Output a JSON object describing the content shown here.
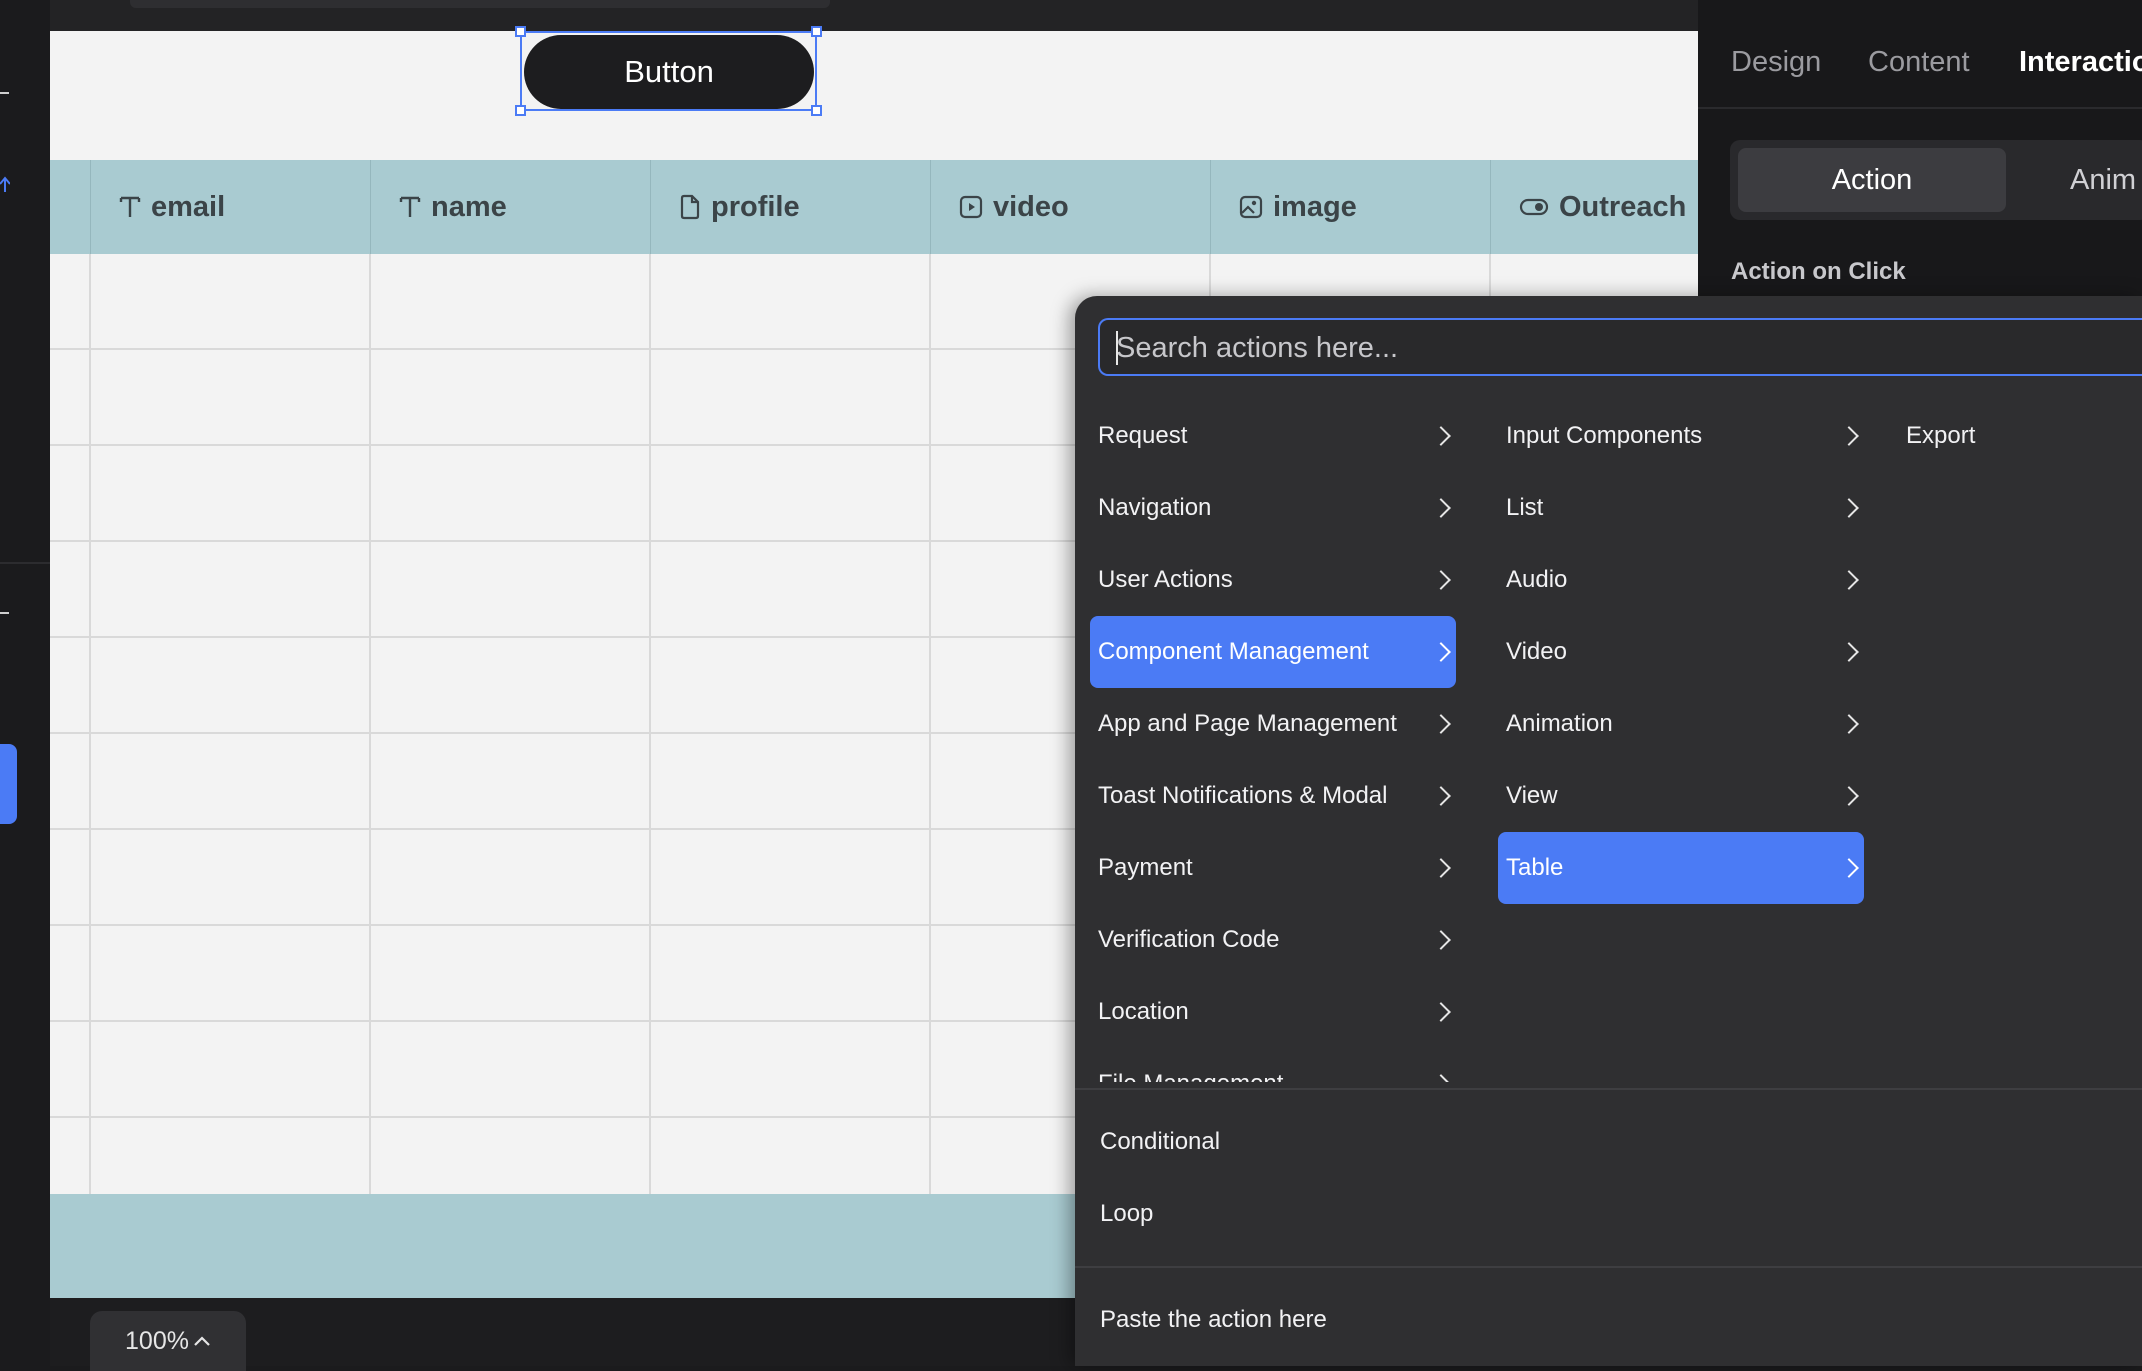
{
  "canvas": {
    "button_label": "Button",
    "zoom_label": "100%"
  },
  "table": {
    "columns": [
      {
        "label": "email",
        "icon": "text-type-icon"
      },
      {
        "label": "name",
        "icon": "text-type-icon"
      },
      {
        "label": "profile",
        "icon": "file-icon"
      },
      {
        "label": "video",
        "icon": "video-icon"
      },
      {
        "label": "image",
        "icon": "image-icon"
      },
      {
        "label": "Outreach",
        "icon": "toggle-icon"
      }
    ]
  },
  "right_panel": {
    "tabs": {
      "design": "Design",
      "content": "Content",
      "interaction": "Interactio"
    },
    "segments": {
      "action": "Action",
      "animation": "Anim"
    },
    "section_label": "Action on Click"
  },
  "action_menu": {
    "search_placeholder": "Search actions here...",
    "col1": [
      "Request",
      "Navigation",
      "User Actions",
      "Component Management",
      "App and Page Management",
      "Toast Notifications & Modal",
      "Payment",
      "Verification Code",
      "Location",
      "File Management"
    ],
    "col2": [
      "Input Components",
      "List",
      "Audio",
      "Video",
      "Animation",
      "View",
      "Table"
    ],
    "col3": [
      "Export"
    ],
    "flow": {
      "conditional": "Conditional",
      "loop": "Loop"
    },
    "paste": "Paste the action here"
  },
  "colors": {
    "accent": "#4b7bf5",
    "table_header": "#a9cbd1",
    "panel": "#2f2f31"
  }
}
